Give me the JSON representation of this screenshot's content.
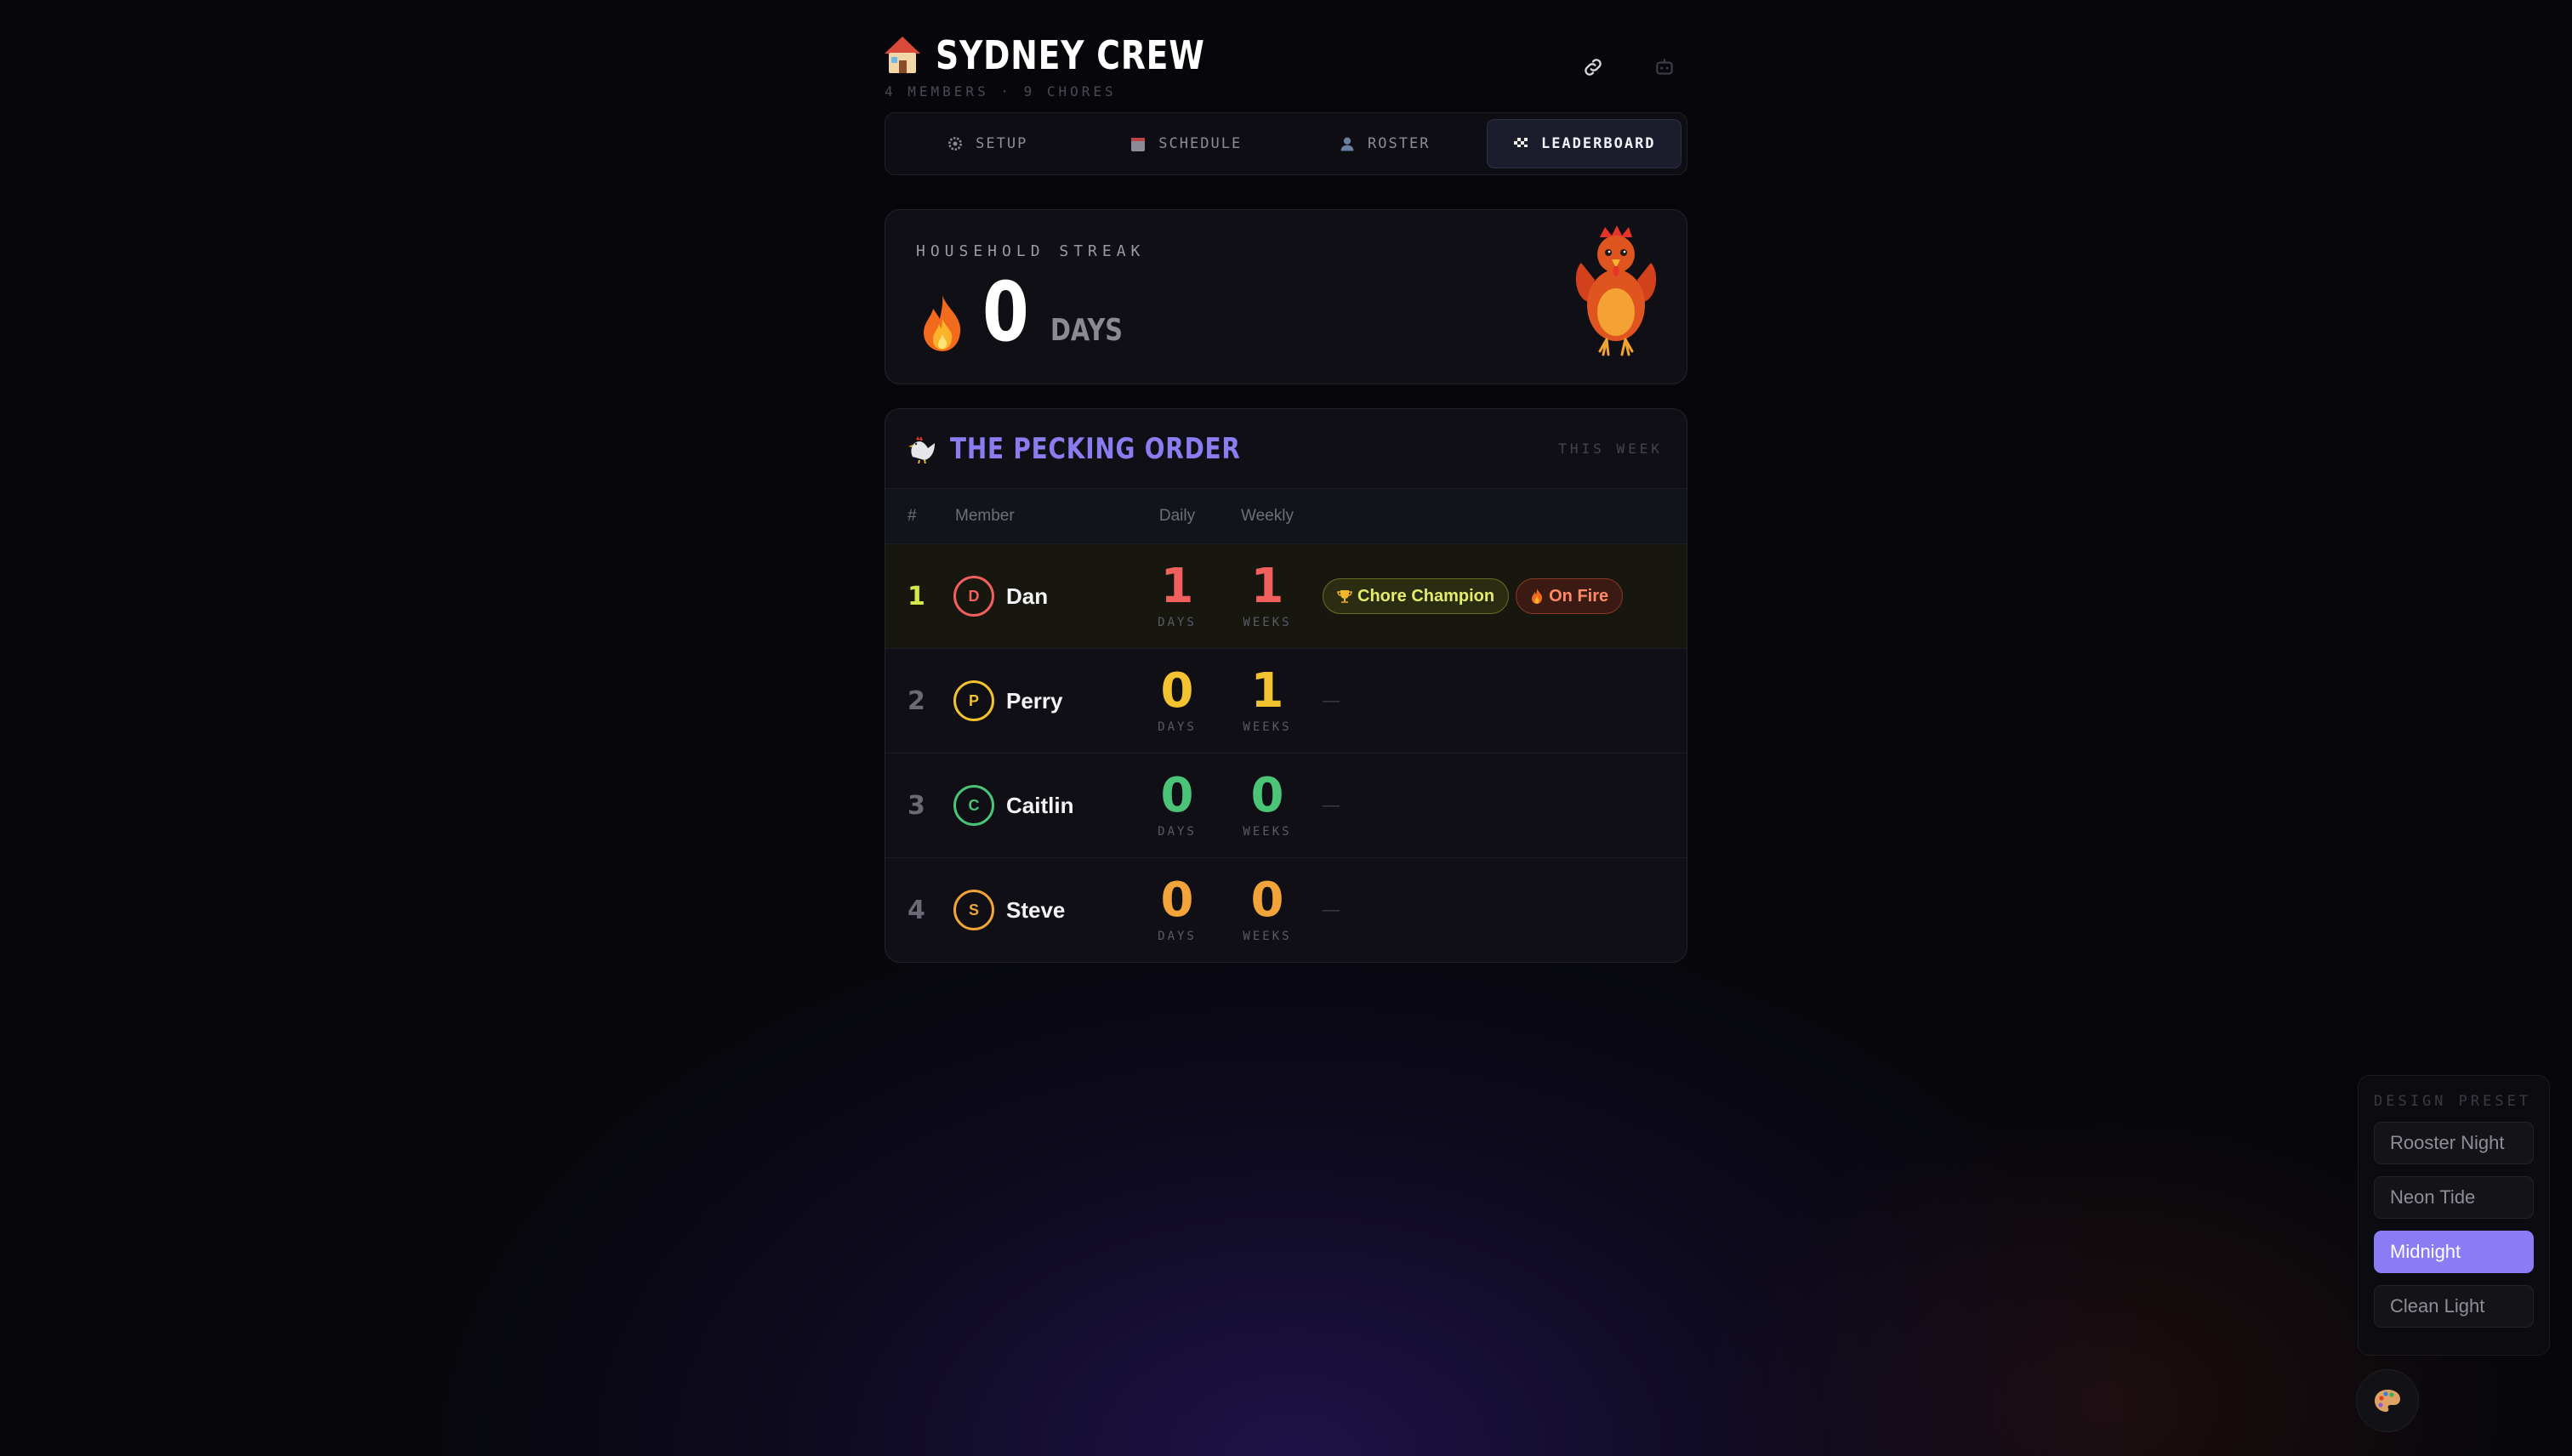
{
  "header": {
    "icon": "house-icon",
    "title": "SYDNEY CREW",
    "subtitle": "4 MEMBERS · 9 CHORES",
    "actions": [
      {
        "name": "link-icon"
      },
      {
        "name": "robot-icon"
      }
    ]
  },
  "tabs": [
    {
      "label": "SETUP",
      "icon": "gear-icon",
      "active": false
    },
    {
      "label": "SCHEDULE",
      "icon": "calendar-icon",
      "active": false
    },
    {
      "label": "ROSTER",
      "icon": "person-icon",
      "active": false
    },
    {
      "label": "LEADERBOARD",
      "icon": "checkered-flag-icon",
      "active": true
    }
  ],
  "streak": {
    "label": "HOUSEHOLD STREAK",
    "value": "0",
    "unit": "DAYS",
    "icon": "fire-icon",
    "mascot": "rooster-mascot"
  },
  "leaderboard": {
    "title": "THE PECKING ORDER",
    "title_icon": "rooster-icon",
    "period": "THIS WEEK",
    "columns": [
      "#",
      "Member",
      "Daily",
      "Weekly"
    ],
    "daily_unit": "DAYS",
    "weekly_unit": "WEEKS",
    "rows": [
      {
        "rank": "1",
        "initial": "D",
        "name": "Dan",
        "daily": "1",
        "weekly": "1",
        "color": "#f2605e",
        "rank_color": "#d6e84a",
        "badges": [
          {
            "label": "Chore Champion",
            "icon": "trophy-icon",
            "kind": "champ"
          },
          {
            "label": "On Fire",
            "icon": "fire-icon",
            "kind": "fire"
          }
        ]
      },
      {
        "rank": "2",
        "initial": "P",
        "name": "Perry",
        "daily": "0",
        "weekly": "1",
        "color": "#f2c230",
        "rank_color": "#6a6a76",
        "badges": []
      },
      {
        "rank": "3",
        "initial": "C",
        "name": "Caitlin",
        "daily": "0",
        "weekly": "0",
        "color": "#4cc477",
        "rank_color": "#6a6a76",
        "badges": []
      },
      {
        "rank": "4",
        "initial": "S",
        "name": "Steve",
        "daily": "0",
        "weekly": "0",
        "color": "#f2a43a",
        "rank_color": "#6a6a76",
        "badges": []
      }
    ],
    "empty_badge": "—"
  },
  "design_preset": {
    "title": "DESIGN PRESET",
    "options": [
      {
        "label": "Rooster Night",
        "active": false
      },
      {
        "label": "Neon Tide",
        "active": false
      },
      {
        "label": "Midnight",
        "active": true
      },
      {
        "label": "Clean Light",
        "active": false
      }
    ],
    "toggle_icon": "palette-icon"
  },
  "colors": {
    "accent": "#8b7cf5",
    "background": "#07070b"
  }
}
